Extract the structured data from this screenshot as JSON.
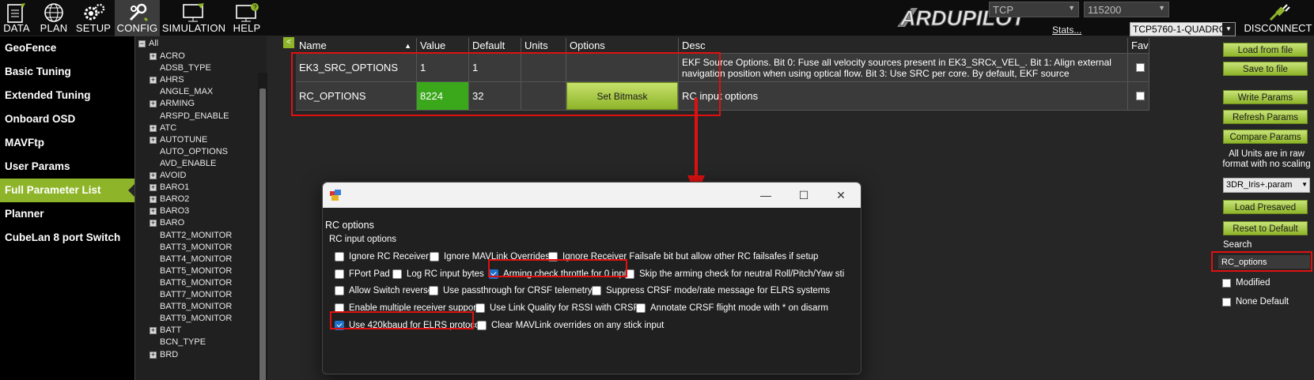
{
  "topbar": {
    "nav": [
      {
        "label": "DATA",
        "icon": "data-icon"
      },
      {
        "label": "PLAN",
        "icon": "globe-icon"
      },
      {
        "label": "SETUP",
        "icon": "gears-icon"
      },
      {
        "label": "CONFIG",
        "icon": "wrench-icon"
      },
      {
        "label": "SIMULATION",
        "icon": "monitor-plane-icon"
      },
      {
        "label": "HELP",
        "icon": "monitor-help-icon"
      }
    ],
    "logo_text": "ARDUPILOT",
    "connection_type": "TCP",
    "baud_rate": "115200",
    "stats_link": "Stats...",
    "connection_target": "TCP5760-1-QUADROTOR",
    "disconnect_label": "DISCONNECT"
  },
  "sidebar": {
    "items": [
      {
        "label": "GeoFence"
      },
      {
        "label": "Basic Tuning"
      },
      {
        "label": "Extended Tuning"
      },
      {
        "label": "Onboard OSD"
      },
      {
        "label": "MAVFtp"
      },
      {
        "label": "User Params"
      },
      {
        "label": "Full Parameter List",
        "active": true
      },
      {
        "label": "Planner"
      },
      {
        "label": "CubeLan 8 port Switch"
      }
    ]
  },
  "tree": {
    "collapse_symbol": "−",
    "expand_symbol": "+",
    "root": "All",
    "items": [
      {
        "label": "ACRO",
        "expandable": true
      },
      {
        "label": "ADSB_TYPE",
        "expandable": false
      },
      {
        "label": "AHRS",
        "expandable": true
      },
      {
        "label": "ANGLE_MAX",
        "expandable": false
      },
      {
        "label": "ARMING",
        "expandable": true
      },
      {
        "label": "ARSPD_ENABLE",
        "expandable": false
      },
      {
        "label": "ATC",
        "expandable": true
      },
      {
        "label": "AUTOTUNE",
        "expandable": true
      },
      {
        "label": "AUTO_OPTIONS",
        "expandable": false
      },
      {
        "label": "AVD_ENABLE",
        "expandable": false
      },
      {
        "label": "AVOID",
        "expandable": true
      },
      {
        "label": "BARO1",
        "expandable": true
      },
      {
        "label": "BARO2",
        "expandable": true
      },
      {
        "label": "BARO3",
        "expandable": true
      },
      {
        "label": "BARO",
        "expandable": true
      },
      {
        "label": "BATT2_MONITOR",
        "expandable": false
      },
      {
        "label": "BATT3_MONITOR",
        "expandable": false
      },
      {
        "label": "BATT4_MONITOR",
        "expandable": false
      },
      {
        "label": "BATT5_MONITOR",
        "expandable": false
      },
      {
        "label": "BATT6_MONITOR",
        "expandable": false
      },
      {
        "label": "BATT7_MONITOR",
        "expandable": false
      },
      {
        "label": "BATT8_MONITOR",
        "expandable": false
      },
      {
        "label": "BATT9_MONITOR",
        "expandable": false
      },
      {
        "label": "BATT",
        "expandable": true
      },
      {
        "label": "BCN_TYPE",
        "expandable": false
      },
      {
        "label": "BRD",
        "expandable": true
      }
    ]
  },
  "collapse_button_label": "<",
  "grid": {
    "headers": {
      "name": "Name",
      "sort_indicator": "▲",
      "value": "Value",
      "default": "Default",
      "units": "Units",
      "options": "Options",
      "desc": "Desc",
      "fav": "Fav"
    },
    "rows": [
      {
        "name": "EK3_SRC_OPTIONS",
        "value": "1",
        "default": "1",
        "units": "",
        "options": "",
        "desc": "EKF Source Options. Bit 0: Fuse all velocity sources present in EK3_SRCx_VEL_. Bit 1: Align external navigation position when using optical flow. Bit 3: Use SRC per core. By default, EKF source"
      },
      {
        "name": "RC_OPTIONS",
        "value": "8224",
        "default": "32",
        "units": "",
        "options": "Set Bitmask",
        "desc": "RC input options"
      }
    ]
  },
  "right_panel": {
    "load_from_file": "Load from file",
    "save_to_file": "Save to file",
    "write_params": "Write Params",
    "refresh_params": "Refresh Params",
    "compare_params": "Compare Params",
    "units_note": "All Units are in raw format with no scaling",
    "param_file": "3DR_Iris+.param",
    "load_presaved": "Load Presaved",
    "reset_to_default": "Reset to Default",
    "search_label": "Search",
    "search_value": "RC_options",
    "modified_label": "Modified",
    "none_default_label": "None Default"
  },
  "dialog": {
    "title": "RC options",
    "subtitle": "RC input options",
    "options": [
      {
        "label": "Ignore RC Receiver",
        "checked": false
      },
      {
        "label": "Ignore MAVLink Overrides",
        "checked": false
      },
      {
        "label": "Ignore Receiver Failsafe bit but allow other RC failsafes if setup",
        "checked": false
      },
      {
        "label": "FPort Pad",
        "checked": false
      },
      {
        "label": "Log RC input bytes",
        "checked": false
      },
      {
        "label": "Arming check throttle for 0 input",
        "checked": true
      },
      {
        "label": "Skip the arming check for neutral Roll/Pitch/Yaw sti",
        "checked": false
      },
      {
        "label": "Allow Switch reverse",
        "checked": false
      },
      {
        "label": "Use passthrough for CRSF telemetry",
        "checked": false
      },
      {
        "label": "Suppress CRSF mode/rate message for ELRS systems",
        "checked": false
      },
      {
        "label": "Enable multiple receiver support",
        "checked": false
      },
      {
        "label": "Use Link Quality for RSSI with CRSF",
        "checked": false
      },
      {
        "label": "Annotate CRSF flight mode with * on disarm",
        "checked": false
      },
      {
        "label": "Use 420kbaud for ELRS protocol",
        "checked": true
      },
      {
        "label": "Clear MAVLink overrides on any stick input",
        "checked": false
      }
    ],
    "window_controls": {
      "minimize": "—",
      "maximize": "☐",
      "close": "✕"
    }
  },
  "colors": {
    "accent_green": "#8eb52a",
    "value_green": "#3ba81c",
    "highlight_red": "#e01010",
    "checkbox_blue": "#1d6fc9"
  }
}
